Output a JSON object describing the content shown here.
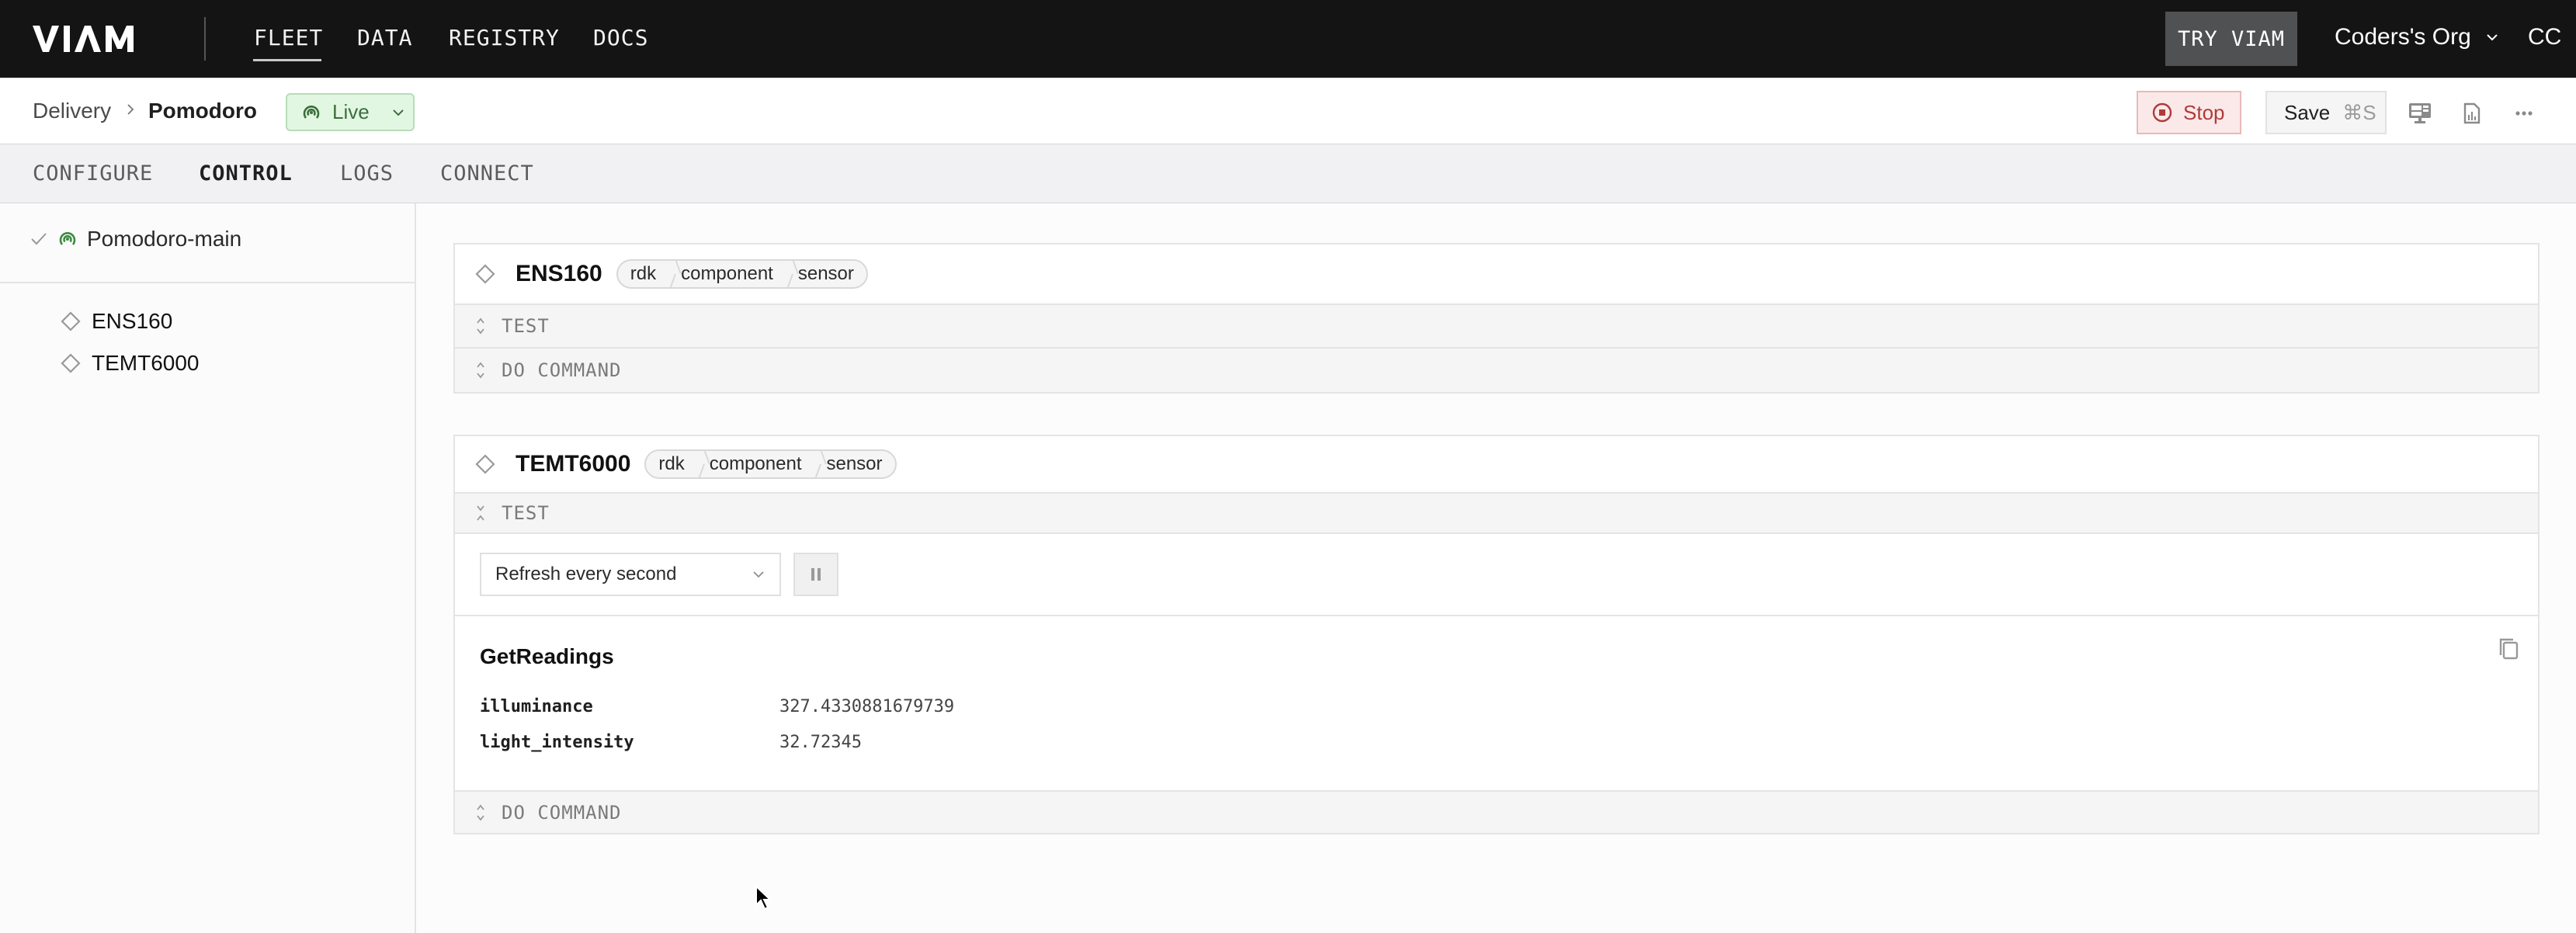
{
  "topnav": {
    "logo": "VIAM",
    "links": [
      "FLEET",
      "DATA",
      "REGISTRY",
      "DOCS"
    ],
    "active_link": "FLEET",
    "try_viam": "TRY VIAM",
    "org": "Coders's Org",
    "user_initials": "CC"
  },
  "subbar": {
    "breadcrumb_parent": "Delivery",
    "breadcrumb_current": "Pomodoro",
    "status": "Live",
    "status_color": "#3d6e3f",
    "stop_label": "Stop",
    "save_label": "Save",
    "save_shortcut": "⌘S",
    "icons": [
      "monitor-icon",
      "document-chart-icon",
      "more-icon"
    ]
  },
  "tabs": [
    "CONFIGURE",
    "CONTROL",
    "LOGS",
    "CONNECT"
  ],
  "active_tab": "CONTROL",
  "sidebar": {
    "robot": "Pomodoro-main",
    "components": [
      "ENS160",
      "TEMT6000"
    ]
  },
  "cards": [
    {
      "name": "ENS160",
      "api": [
        "rdk",
        "component",
        "sensor"
      ],
      "sections": [
        "TEST",
        "DO COMMAND"
      ],
      "test_expanded": false
    },
    {
      "name": "TEMT6000",
      "api": [
        "rdk",
        "component",
        "sensor"
      ],
      "sections": [
        "TEST",
        "DO COMMAND"
      ],
      "test_expanded": true,
      "refresh_option": "Refresh every second",
      "readings_title": "GetReadings",
      "readings": [
        {
          "key": "illuminance",
          "value": "327.4330881679739"
        },
        {
          "key": "light_intensity",
          "value": "32.72345"
        }
      ]
    }
  ]
}
